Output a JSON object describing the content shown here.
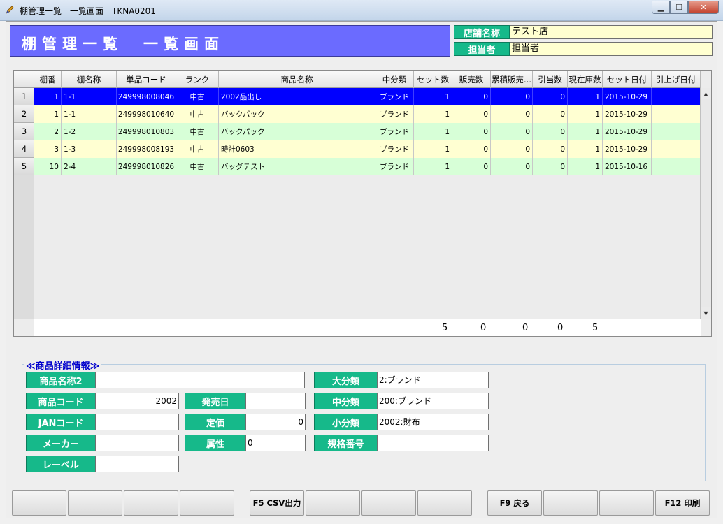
{
  "window": {
    "title": "棚管理一覧　一覧画面　TKNA0201",
    "buttons": {
      "minimize": "▁",
      "maximize": "☐",
      "close": "✕"
    }
  },
  "header": {
    "title": "棚管理一覧　一覧画面",
    "store_label": "店舗名称",
    "store_value": "テスト店",
    "staff_label": "担当者",
    "staff_value": "担当者"
  },
  "grid": {
    "columns": [
      "棚番",
      "棚名称",
      "単品コード",
      "ランク",
      "商品名称",
      "中分類",
      "セット数",
      "販売数",
      "累積販売...",
      "引当数",
      "現在庫数",
      "セット日付",
      "引上げ日付"
    ],
    "rows": [
      {
        "num": "1",
        "shelf_no": "1",
        "shelf_name": "1-1",
        "code": "249998008046",
        "rank": "中古",
        "product": "2002品出し",
        "category": "ブランド",
        "set_qty": "1",
        "sold": "0",
        "cumulative": "0",
        "allocated": "0",
        "stock": "1",
        "set_date": "2015-10-29",
        "pull_date": ""
      },
      {
        "num": "2",
        "shelf_no": "1",
        "shelf_name": "1-1",
        "code": "249998010640",
        "rank": "中古",
        "product": "バックパック",
        "category": "ブランド",
        "set_qty": "1",
        "sold": "0",
        "cumulative": "0",
        "allocated": "0",
        "stock": "1",
        "set_date": "2015-10-29",
        "pull_date": ""
      },
      {
        "num": "3",
        "shelf_no": "2",
        "shelf_name": "1-2",
        "code": "249998010803",
        "rank": "中古",
        "product": "バックパック",
        "category": "ブランド",
        "set_qty": "1",
        "sold": "0",
        "cumulative": "0",
        "allocated": "0",
        "stock": "1",
        "set_date": "2015-10-29",
        "pull_date": ""
      },
      {
        "num": "4",
        "shelf_no": "3",
        "shelf_name": "1-3",
        "code": "249998008193",
        "rank": "中古",
        "product": "時計0603",
        "category": "ブランド",
        "set_qty": "1",
        "sold": "0",
        "cumulative": "0",
        "allocated": "0",
        "stock": "1",
        "set_date": "2015-10-29",
        "pull_date": ""
      },
      {
        "num": "5",
        "shelf_no": "10",
        "shelf_name": "2-4",
        "code": "249998010826",
        "rank": "中古",
        "product": "バッグテスト",
        "category": "ブランド",
        "set_qty": "1",
        "sold": "0",
        "cumulative": "0",
        "allocated": "0",
        "stock": "1",
        "set_date": "2015-10-16",
        "pull_date": ""
      }
    ],
    "totals": {
      "set_qty": "5",
      "sold": "0",
      "cumulative": "0",
      "allocated": "0",
      "stock": "5"
    },
    "scroll_up": "▲",
    "scroll_down": "▼"
  },
  "detail": {
    "title": "≪商品詳細情報≫",
    "product_name2_label": "商品名称2",
    "product_name2_value": "",
    "product_code_label": "商品コード",
    "product_code_value": "2002",
    "jan_label": "JANコード",
    "jan_value": "",
    "maker_label": "メーカー",
    "maker_value": "",
    "level_label": "レーベル",
    "level_value": "",
    "release_label": "発売日",
    "release_value": "",
    "price_label": "定価",
    "price_value": "0",
    "attr_label": "属性",
    "attr_value": "0",
    "major_label": "大分類",
    "major_value": "2:ブランド",
    "middle_label": "中分類",
    "middle_value": "200:ブランド",
    "minor_label": "小分類",
    "minor_value": "2002:財布",
    "spec_label": "規格番号",
    "spec_value": ""
  },
  "fkeys": [
    "",
    "",
    "",
    "",
    "F5 CSV出力",
    "",
    "",
    "",
    "F9 戻る",
    "",
    "",
    "F12 印刷"
  ]
}
